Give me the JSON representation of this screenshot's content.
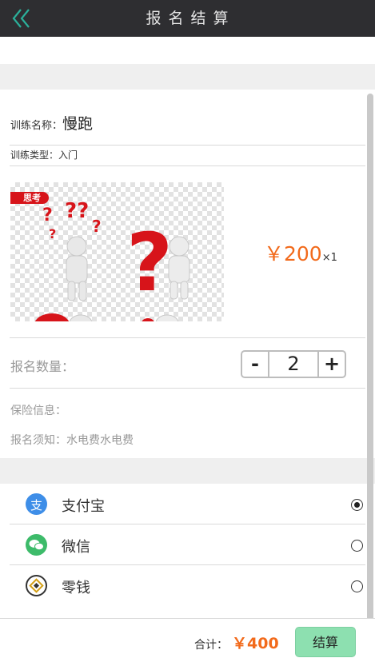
{
  "header": {
    "title": "报名结算"
  },
  "training": {
    "name_label": "训练名称：",
    "name_value": "慢跑",
    "type_label": "训练类型：入门",
    "image_tag": "思考"
  },
  "price": {
    "amount": "￥200",
    "multiplier": "×1"
  },
  "quantity": {
    "label": "报名数量：",
    "minus": "-",
    "value": "2",
    "plus": "+"
  },
  "insurance_label": "保险信息：",
  "notice": "报名须知：水电费水电费",
  "payment": {
    "options": [
      {
        "label": "支付宝",
        "icon": "alipay-icon",
        "selected": true
      },
      {
        "label": "微信",
        "icon": "wechat-icon",
        "selected": false
      },
      {
        "label": "零钱",
        "icon": "wallet-icon",
        "selected": false
      }
    ]
  },
  "footer": {
    "total_label": "合计：",
    "total_value": "￥400",
    "checkout_label": "结算"
  },
  "colors": {
    "accent": "#f26a1b",
    "checkout": "#8de0b0",
    "header_bg": "#2e2e31",
    "back_icon": "#2bb09a"
  }
}
